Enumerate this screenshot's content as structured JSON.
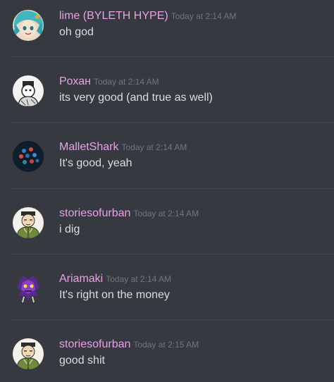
{
  "messages": [
    {
      "username": "lime (BYLETH HYPE)",
      "timestamp": "Today at 2:14 AM",
      "content": "oh god",
      "avatar": "teal-haired-anime-avatar"
    },
    {
      "username": "Pохан",
      "timestamp": "Today at 2:14 AM",
      "content": "its very good (and true as well)",
      "avatar": "sketch-character-avatar"
    },
    {
      "username": "MalletShark",
      "timestamp": "Today at 2:14 AM",
      "content": "It's good, yeah",
      "avatar": "dark-dots-avatar"
    },
    {
      "username": "storiesofurban",
      "timestamp": "Today at 2:14 AM",
      "content": "i dig",
      "avatar": "green-coat-character-avatar"
    },
    {
      "username": "Ariamaki",
      "timestamp": "Today at 2:14 AM",
      "content": "It's right on the money",
      "avatar": "purple-creature-avatar"
    },
    {
      "username": "storiesofurban",
      "timestamp": "Today at 2:15 AM",
      "content": "good shit",
      "avatar": "green-coat-character-avatar"
    }
  ],
  "colors": {
    "background": "#36393f",
    "username": "#e7a2e8",
    "timestamp": "#72767d",
    "text": "#dcddde",
    "divider": "#42454a"
  }
}
